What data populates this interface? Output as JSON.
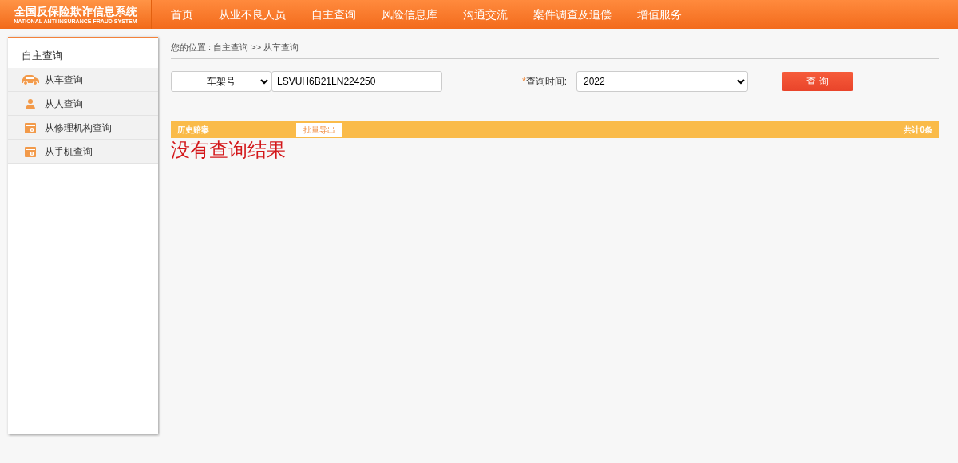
{
  "header": {
    "logo_title": "全国反保险欺诈信息系统",
    "logo_subtitle": "NATIONAL ANTI INSURANCE FRAUD SYSTEM",
    "nav": [
      "首页",
      "从业不良人员",
      "自主查询",
      "风险信息库",
      "沟通交流",
      "案件调查及追偿",
      "增值服务"
    ]
  },
  "sidebar": {
    "title": "自主查询",
    "items": [
      {
        "label": "从车查询",
        "kind": "car"
      },
      {
        "label": "从人查询",
        "kind": "person"
      },
      {
        "label": "从修理机构查询",
        "kind": "folder"
      },
      {
        "label": "从手机查询",
        "kind": "folder"
      }
    ]
  },
  "breadcrumb": "您的位置 : 自主查询 >> 从车查询",
  "search": {
    "type_select": "车架号",
    "vin_value": "LSVUH6B21LN224250",
    "required_mark": "*",
    "time_label": "查询时间:",
    "time_select": "2022",
    "query_button": "查 询"
  },
  "results": {
    "title": "历史赔案",
    "export_button": "批量导出",
    "count": "共计0条",
    "empty_message": "没有查询结果"
  }
}
